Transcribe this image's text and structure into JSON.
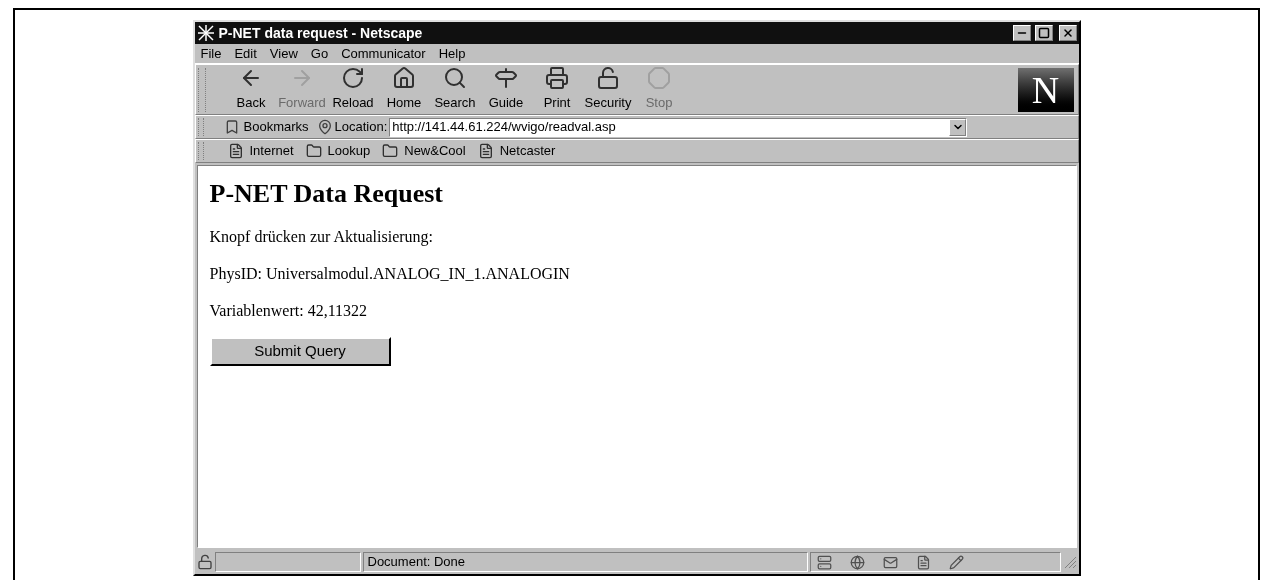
{
  "window": {
    "title": "P-NET data request - Netscape"
  },
  "menu": [
    "File",
    "Edit",
    "View",
    "Go",
    "Communicator",
    "Help"
  ],
  "toolbar": [
    {
      "label": "Back",
      "kind": "back",
      "disabled": false
    },
    {
      "label": "Forward",
      "kind": "forward",
      "disabled": true
    },
    {
      "label": "Reload",
      "kind": "reload",
      "disabled": false
    },
    {
      "label": "Home",
      "kind": "home",
      "disabled": false
    },
    {
      "label": "Search",
      "kind": "search",
      "disabled": false
    },
    {
      "label": "Guide",
      "kind": "guide",
      "disabled": false
    },
    {
      "label": "Print",
      "kind": "print",
      "disabled": false
    },
    {
      "label": "Security",
      "kind": "security",
      "disabled": false
    },
    {
      "label": "Stop",
      "kind": "stop",
      "disabled": true
    }
  ],
  "logo": "N",
  "location_bar": {
    "bookmarks": "Bookmarks",
    "label": "Location:",
    "url": "http://141.44.61.224/wvigo/readval.asp"
  },
  "personal_toolbar": [
    {
      "label": "Internet",
      "kind": "page"
    },
    {
      "label": "Lookup",
      "kind": "folder"
    },
    {
      "label": "New&Cool",
      "kind": "folder"
    },
    {
      "label": "Netcaster",
      "kind": "page"
    }
  ],
  "page": {
    "heading": "P-NET Data Request",
    "lines": [
      "Knopf drücken zur Aktualisierung:",
      "PhysID: Universalmodul.ANALOG_IN_1.ANALOGIN",
      "Variablenwert: 42,11322"
    ],
    "button": "Submit Query"
  },
  "status_bar": {
    "text": "Document: Done"
  }
}
